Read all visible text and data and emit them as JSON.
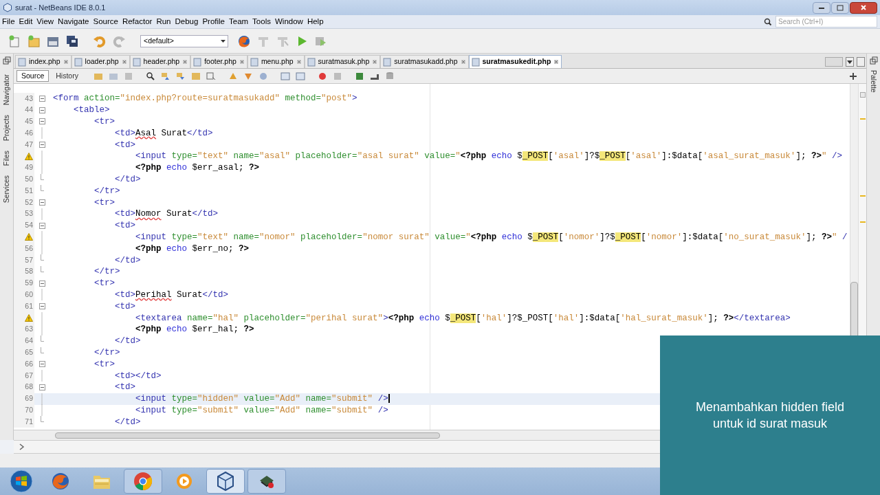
{
  "window": {
    "title": "surat - NetBeans IDE 8.0.1"
  },
  "menu": [
    "File",
    "Edit",
    "View",
    "Navigate",
    "Source",
    "Refactor",
    "Run",
    "Debug",
    "Profile",
    "Team",
    "Tools",
    "Window",
    "Help"
  ],
  "toolbar": {
    "config": "<default>",
    "search_placeholder": "Search (Ctrl+I)"
  },
  "tabs": [
    {
      "label": "index.php",
      "selected": false
    },
    {
      "label": "loader.php",
      "selected": false
    },
    {
      "label": "header.php",
      "selected": false
    },
    {
      "label": "footer.php",
      "selected": false
    },
    {
      "label": "menu.php",
      "selected": false
    },
    {
      "label": "suratmasuk.php",
      "selected": false
    },
    {
      "label": "suratmasukadd.php",
      "selected": false
    },
    {
      "label": "suratmasukedit.php",
      "selected": true
    }
  ],
  "editor_modes": [
    {
      "label": "Source",
      "selected": true
    },
    {
      "label": "History",
      "selected": false
    }
  ],
  "side_panels_left": [
    "Navigator",
    "Projects",
    "Files",
    "Services"
  ],
  "side_panels_right": [
    "Palette"
  ],
  "code_lines": [
    {
      "number": "43",
      "kind": "fold",
      "current": false,
      "tokens": [
        {
          "kind": "tag",
          "t": "<form"
        },
        {
          "kind": "attr",
          "t": " action="
        },
        {
          "kind": "str",
          "t": "\"index.php?route=suratmasukadd\""
        },
        {
          "kind": "attr",
          "t": " method="
        },
        {
          "kind": "str",
          "t": "\"post\""
        },
        {
          "kind": "tag",
          "t": ">"
        }
      ]
    },
    {
      "number": "44",
      "kind": "fold",
      "current": false,
      "tokens": [
        {
          "kind": "tag",
          "t": "    <table>"
        }
      ]
    },
    {
      "number": "45",
      "kind": "fold",
      "current": false,
      "tokens": [
        {
          "kind": "tag",
          "t": "        <tr>"
        }
      ]
    },
    {
      "number": "46",
      "kind": "line",
      "current": false,
      "tokens": [
        {
          "kind": "tag",
          "t": "            <td>"
        },
        {
          "kind": "err",
          "t": "Asal"
        },
        {
          "kind": "plain",
          "t": " Surat"
        },
        {
          "kind": "tag",
          "t": "</td>"
        }
      ]
    },
    {
      "number": "47",
      "kind": "fold",
      "current": false,
      "tokens": [
        {
          "kind": "tag",
          "t": "            <td>"
        }
      ]
    },
    {
      "kind": "warning",
      "current": false,
      "tokens": [
        {
          "kind": "tag",
          "t": "                <input"
        },
        {
          "kind": "attr",
          "t": " type="
        },
        {
          "kind": "str",
          "t": "\"text\""
        },
        {
          "kind": "attr",
          "t": " name="
        },
        {
          "kind": "str",
          "t": "\"asal\""
        },
        {
          "kind": "attr",
          "t": " placeholder="
        },
        {
          "kind": "str",
          "t": "\"asal surat\""
        },
        {
          "kind": "attr",
          "t": " value="
        },
        {
          "kind": "str",
          "t": "\""
        },
        {
          "kind": "php",
          "t": "<?php"
        },
        {
          "kind": "kw",
          "t": " echo "
        },
        {
          "kind": "plain",
          "t": "$"
        },
        {
          "kind": "post",
          "t": "_POST"
        },
        {
          "kind": "plain",
          "t": "["
        },
        {
          "kind": "str",
          "t": "'asal'"
        },
        {
          "kind": "plain",
          "t": "]?$"
        },
        {
          "kind": "post",
          "t": "_POST"
        },
        {
          "kind": "plain",
          "t": "["
        },
        {
          "kind": "str",
          "t": "'asal'"
        },
        {
          "kind": "plain",
          "t": "]:$data["
        },
        {
          "kind": "str",
          "t": "'asal_surat_masuk'"
        },
        {
          "kind": "plain",
          "t": "]; "
        },
        {
          "kind": "php",
          "t": "?>"
        },
        {
          "kind": "str",
          "t": "\""
        },
        {
          "kind": "tag",
          "t": " />"
        }
      ]
    },
    {
      "number": "49",
      "kind": "line",
      "current": false,
      "tokens": [
        {
          "kind": "php",
          "t": "                <?php"
        },
        {
          "kind": "kw",
          "t": " echo "
        },
        {
          "kind": "plain",
          "t": "$err_asal; "
        },
        {
          "kind": "php",
          "t": "?>"
        }
      ]
    },
    {
      "number": "50",
      "kind": "end",
      "current": false,
      "tokens": [
        {
          "kind": "tag",
          "t": "            </td>"
        }
      ]
    },
    {
      "number": "51",
      "kind": "end",
      "current": false,
      "tokens": [
        {
          "kind": "tag",
          "t": "        </tr>"
        }
      ]
    },
    {
      "number": "52",
      "kind": "fold",
      "current": false,
      "tokens": [
        {
          "kind": "tag",
          "t": "        <tr>"
        }
      ]
    },
    {
      "number": "53",
      "kind": "line",
      "current": false,
      "tokens": [
        {
          "kind": "tag",
          "t": "            <td>"
        },
        {
          "kind": "err",
          "t": "Nomor"
        },
        {
          "kind": "plain",
          "t": " Surat"
        },
        {
          "kind": "tag",
          "t": "</td>"
        }
      ]
    },
    {
      "number": "54",
      "kind": "fold",
      "current": false,
      "tokens": [
        {
          "kind": "tag",
          "t": "            <td>"
        }
      ]
    },
    {
      "kind": "warning",
      "current": false,
      "tokens": [
        {
          "kind": "tag",
          "t": "                <input"
        },
        {
          "kind": "attr",
          "t": " type="
        },
        {
          "kind": "str",
          "t": "\"text\""
        },
        {
          "kind": "attr",
          "t": " name="
        },
        {
          "kind": "str",
          "t": "\"nomor\""
        },
        {
          "kind": "attr",
          "t": " placeholder="
        },
        {
          "kind": "str",
          "t": "\"nomor surat\""
        },
        {
          "kind": "attr",
          "t": " value="
        },
        {
          "kind": "str",
          "t": "\""
        },
        {
          "kind": "php",
          "t": "<?php"
        },
        {
          "kind": "kw",
          "t": " echo "
        },
        {
          "kind": "plain",
          "t": "$"
        },
        {
          "kind": "post",
          "t": "_POST"
        },
        {
          "kind": "plain",
          "t": "["
        },
        {
          "kind": "str",
          "t": "'nomor'"
        },
        {
          "kind": "plain",
          "t": "]?$"
        },
        {
          "kind": "post",
          "t": "_POST"
        },
        {
          "kind": "plain",
          "t": "["
        },
        {
          "kind": "str",
          "t": "'nomor'"
        },
        {
          "kind": "plain",
          "t": "]:$data["
        },
        {
          "kind": "str",
          "t": "'no_surat_masuk'"
        },
        {
          "kind": "plain",
          "t": "]; "
        },
        {
          "kind": "php",
          "t": "?>"
        },
        {
          "kind": "str",
          "t": "\""
        },
        {
          "kind": "tag",
          "t": " /"
        }
      ]
    },
    {
      "number": "56",
      "kind": "line",
      "current": false,
      "tokens": [
        {
          "kind": "php",
          "t": "                <?php"
        },
        {
          "kind": "kw",
          "t": " echo "
        },
        {
          "kind": "plain",
          "t": "$err_no; "
        },
        {
          "kind": "php",
          "t": "?>"
        }
      ]
    },
    {
      "number": "57",
      "kind": "end",
      "current": false,
      "tokens": [
        {
          "kind": "tag",
          "t": "            </td>"
        }
      ]
    },
    {
      "number": "58",
      "kind": "end",
      "current": false,
      "tokens": [
        {
          "kind": "tag",
          "t": "        </tr>"
        }
      ]
    },
    {
      "number": "59",
      "kind": "fold",
      "current": false,
      "tokens": [
        {
          "kind": "tag",
          "t": "        <tr>"
        }
      ]
    },
    {
      "number": "60",
      "kind": "line",
      "current": false,
      "tokens": [
        {
          "kind": "tag",
          "t": "            <td>"
        },
        {
          "kind": "err",
          "t": "Perihal"
        },
        {
          "kind": "plain",
          "t": " Surat"
        },
        {
          "kind": "tag",
          "t": "</td>"
        }
      ]
    },
    {
      "number": "61",
      "kind": "fold",
      "current": false,
      "tokens": [
        {
          "kind": "tag",
          "t": "            <td>"
        }
      ]
    },
    {
      "kind": "warning",
      "current": false,
      "tokens": [
        {
          "kind": "tag",
          "t": "                <textarea"
        },
        {
          "kind": "attr",
          "t": " name="
        },
        {
          "kind": "str",
          "t": "\"hal\""
        },
        {
          "kind": "attr",
          "t": " placeholder="
        },
        {
          "kind": "str",
          "t": "\"perihal surat\""
        },
        {
          "kind": "tag",
          "t": ">"
        },
        {
          "kind": "php",
          "t": "<?php"
        },
        {
          "kind": "kw",
          "t": " echo "
        },
        {
          "kind": "plain",
          "t": "$"
        },
        {
          "kind": "post",
          "t": "_POST"
        },
        {
          "kind": "plain",
          "t": "["
        },
        {
          "kind": "str",
          "t": "'hal'"
        },
        {
          "kind": "plain",
          "t": "]?$_POST["
        },
        {
          "kind": "str",
          "t": "'hal'"
        },
        {
          "kind": "plain",
          "t": "]:$data["
        },
        {
          "kind": "str",
          "t": "'hal_surat_masuk'"
        },
        {
          "kind": "plain",
          "t": "]; "
        },
        {
          "kind": "php",
          "t": "?>"
        },
        {
          "kind": "tag",
          "t": "</textarea>"
        }
      ]
    },
    {
      "number": "63",
      "kind": "line",
      "current": false,
      "tokens": [
        {
          "kind": "php",
          "t": "                <?php"
        },
        {
          "kind": "kw",
          "t": " echo "
        },
        {
          "kind": "plain",
          "t": "$err_hal; "
        },
        {
          "kind": "php",
          "t": "?>"
        }
      ]
    },
    {
      "number": "64",
      "kind": "end",
      "current": false,
      "tokens": [
        {
          "kind": "tag",
          "t": "            </td>"
        }
      ]
    },
    {
      "number": "65",
      "kind": "end",
      "current": false,
      "tokens": [
        {
          "kind": "tag",
          "t": "        </tr>"
        }
      ]
    },
    {
      "number": "66",
      "kind": "fold",
      "current": false,
      "tokens": [
        {
          "kind": "tag",
          "t": "        <tr>"
        }
      ]
    },
    {
      "number": "67",
      "kind": "line",
      "current": false,
      "tokens": [
        {
          "kind": "tag",
          "t": "            <td></td>"
        }
      ]
    },
    {
      "number": "68",
      "kind": "fold",
      "current": false,
      "tokens": [
        {
          "kind": "tag",
          "t": "            <td>"
        }
      ]
    },
    {
      "number": "69",
      "kind": "line",
      "current": true,
      "tokens": [
        {
          "kind": "tag",
          "t": "                <input"
        },
        {
          "kind": "attr",
          "t": " type="
        },
        {
          "kind": "str",
          "t": "\"hidden\""
        },
        {
          "kind": "attr",
          "t": " value="
        },
        {
          "kind": "str",
          "t": "\"Add\""
        },
        {
          "kind": "attr",
          "t": " name="
        },
        {
          "kind": "str",
          "t": "\"submit\""
        },
        {
          "kind": "tag",
          "t": " />"
        }
      ]
    },
    {
      "number": "70",
      "kind": "line",
      "current": false,
      "tokens": [
        {
          "kind": "tag",
          "t": "                <input"
        },
        {
          "kind": "attr",
          "t": " type="
        },
        {
          "kind": "str",
          "t": "\"submit\""
        },
        {
          "kind": "attr",
          "t": " value="
        },
        {
          "kind": "str",
          "t": "\"Add\""
        },
        {
          "kind": "attr",
          "t": " name="
        },
        {
          "kind": "str",
          "t": "\"submit\""
        },
        {
          "kind": "tag",
          "t": " />"
        }
      ]
    },
    {
      "number": "71",
      "kind": "end",
      "current": false,
      "tokens": [
        {
          "kind": "tag",
          "t": "            </td>"
        }
      ]
    }
  ],
  "caption": "Menambahkan hidden field untuk id surat masuk",
  "taskbar": [
    {
      "kind": "start",
      "selected": false,
      "running": false
    },
    {
      "kind": "fox",
      "selected": false,
      "running": false
    },
    {
      "kind": "folder",
      "selected": false,
      "running": false
    },
    {
      "kind": "chrome",
      "selected": false,
      "running": true
    },
    {
      "kind": "player",
      "selected": false,
      "running": false
    },
    {
      "kind": "cube",
      "selected": true,
      "running": true
    },
    {
      "kind": "app",
      "selected": false,
      "running": true
    }
  ]
}
